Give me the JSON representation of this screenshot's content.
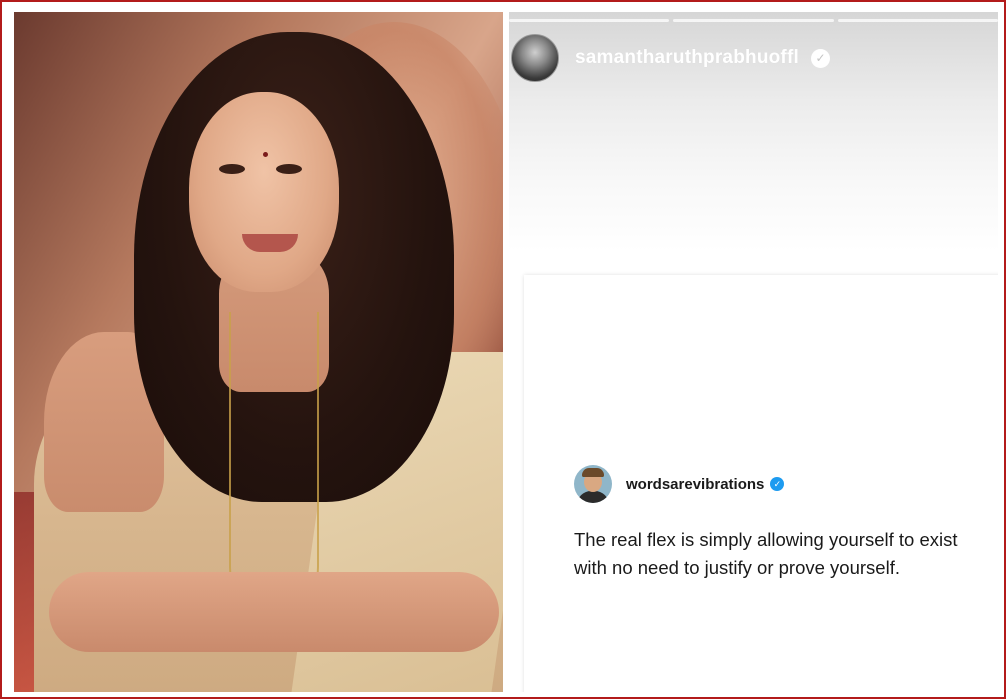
{
  "photo": {
    "description_icon": "portrait-photo"
  },
  "story": {
    "progress_segments": 3,
    "username": "samantharuthprabhuoffl",
    "verified_icon": "verified-badge-icon",
    "tweet": {
      "handle": "wordsarevibrations",
      "verified_icon": "verified-badge-icon",
      "text_line1": "The real flex is simply allowing yourself to exist",
      "text_line2": "with no need to justify or prove yourself."
    }
  },
  "colors": {
    "frame_border": "#b31b1b",
    "verified_blue": "#1d9bf0"
  }
}
